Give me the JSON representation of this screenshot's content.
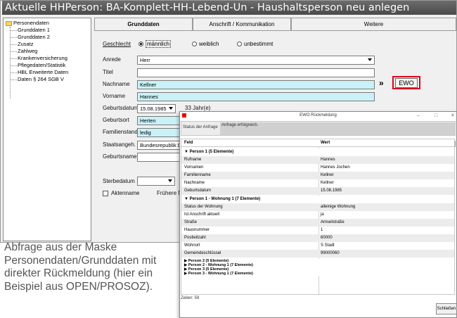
{
  "window": {
    "title": "Aktuelle HHPerson: BA-Komplett-HH-Lebend-Un - Haushaltsperson neu anlegen"
  },
  "tree": {
    "root": "Personendaten",
    "items": [
      "Grunddaten 1",
      "Grunddaten 2",
      "Zusatz",
      "Zahlweg",
      "Krankenversicherung",
      "Pflegedaten/Statistik",
      "HBL Erweiterte Daten",
      "Daten § 264 SGB V"
    ]
  },
  "tabs": [
    "Grunddaten",
    "Anschrift / Kommunikation",
    "Weitere"
  ],
  "form": {
    "geschlecht_label": "Geschlecht",
    "radio_male": "männlich",
    "radio_female": "weiblich",
    "radio_unknown": "unbestimmt",
    "anrede_label": "Anrede",
    "anrede_value": "Herr",
    "titel_label": "Titel",
    "titel_value": "",
    "nachname_label": "Nachname",
    "nachname_value": "Kellner",
    "vorname_label": "Vorname",
    "vorname_value": "Hannes",
    "geburtsdatum_label": "Geburtsdatum",
    "geburtsdatum_value": "15.08.1985",
    "age_text": "33 Jahr(e)",
    "geburtsort_label": "Geburtsort",
    "geburtsort_value": "Herten",
    "familienstand_label": "Familienstand",
    "familienstand_value": "ledig",
    "staatsangeh_label": "Staatsangeh.",
    "staatsangeh_value": "Bundesrepublik D",
    "geburtsname_label": "Geburtsname",
    "geburtsname_value": "",
    "sterbedatum_label": "Sterbedatum",
    "aktenname_label": "Aktenname",
    "fruehere_label": "Frühere N",
    "ewo_button": "EWO",
    "arrow": "»"
  },
  "popup": {
    "title": "EWO Rückmeldung",
    "controls": [
      "–",
      "□",
      "✕"
    ],
    "status_label": "Status der Anfrage",
    "status_value": "Anfrage erfolgreich.",
    "col_feld": "Feld",
    "col_wert": "Wert",
    "group1": "Person 1 (5 Elemente)",
    "person": [
      [
        "Rufname",
        "Hannes"
      ],
      [
        "Vornamen",
        "Hannes Jochen"
      ],
      [
        "Familienname",
        "Kellner"
      ],
      [
        "Nachname",
        "Kellner"
      ],
      [
        "Geburtsdatum",
        "15.08.1985"
      ]
    ],
    "group2": "Person 1 - Wohnung 1 (7 Elemente)",
    "wohnung": [
      [
        "Status der Wohnung",
        "alleinige Wohnung"
      ],
      [
        "Ist Anschrift aktuell",
        "ja"
      ],
      [
        "Straße",
        "Amselstraße"
      ],
      [
        "Hausnummer",
        "1"
      ],
      [
        "Postleitzahl",
        "60000"
      ],
      [
        "Wohnort",
        "S Stadt"
      ],
      [
        "Gemeindeschlüssel",
        "99000060"
      ]
    ],
    "collapsed": [
      "Person 2 (5 Elemente)",
      "Person 2 - Wohnung 1 (7 Elemente)",
      "Person 3 (5 Elemente)",
      "Person 3 - Wohnung 1 (7 Elemente)"
    ],
    "footer": "Zeilen: 59",
    "close_button": "Schließen"
  },
  "caption": "Abfrage aus der Maske Personendaten/Grunddaten mit direkter Rückmeldung (hier ein Beispiel aus OPEN/PROSOZ)."
}
